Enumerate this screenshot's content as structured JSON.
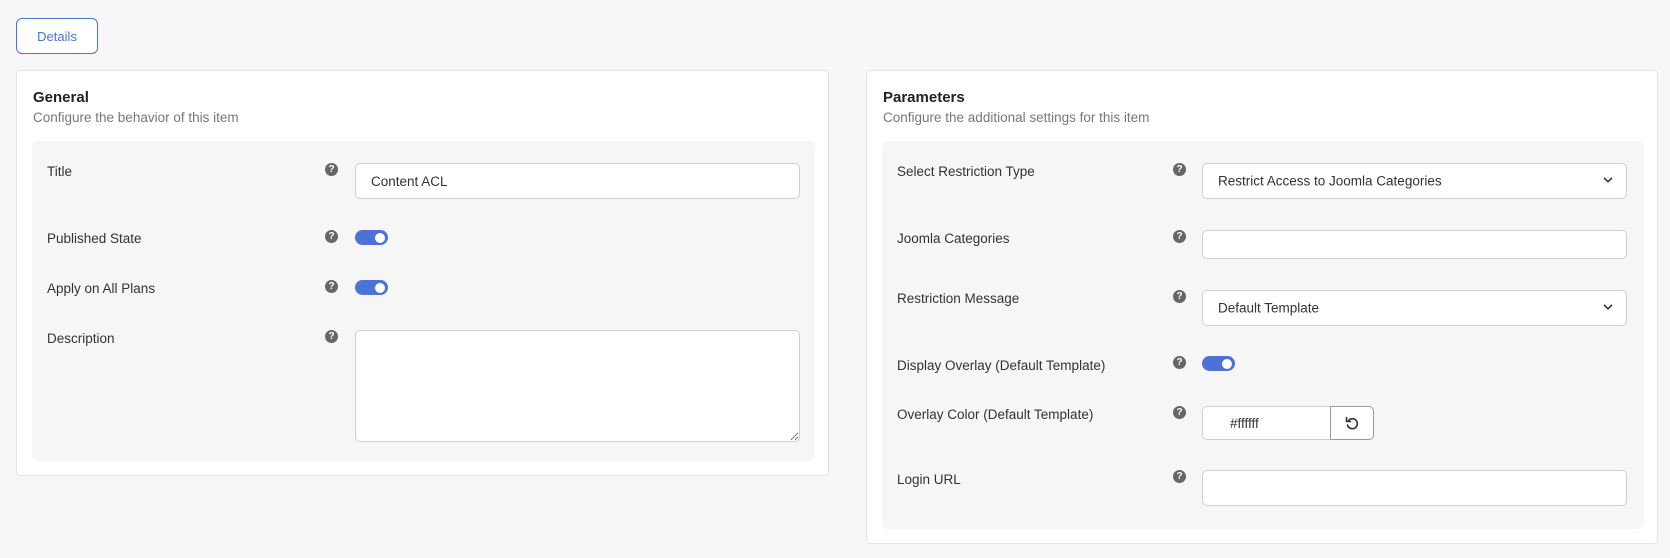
{
  "tabs": [
    {
      "label": "Details"
    }
  ],
  "general": {
    "title": "General",
    "subtitle": "Configure the behavior of this item",
    "fields": {
      "title": {
        "label": "Title",
        "value": "Content ACL"
      },
      "published": {
        "label": "Published State",
        "enabled": true
      },
      "apply_all": {
        "label": "Apply on All Plans",
        "enabled": true
      },
      "description": {
        "label": "Description",
        "value": ""
      }
    }
  },
  "parameters": {
    "title": "Parameters",
    "subtitle": "Configure the additional settings for this item",
    "fields": {
      "restriction_type": {
        "label": "Select Restriction Type",
        "value": "Restrict Access to Joomla Categories"
      },
      "categories": {
        "label": "Joomla Categories",
        "value": ""
      },
      "restriction_message": {
        "label": "Restriction Message",
        "value": "Default Template"
      },
      "display_overlay": {
        "label": "Display Overlay (Default Template)",
        "enabled": true
      },
      "overlay_color": {
        "label": "Overlay Color (Default Template)",
        "value": "#ffffff"
      },
      "login_url": {
        "label": "Login URL",
        "value": ""
      }
    }
  },
  "icons": {
    "help": "question-circle-icon",
    "select": "chevron-down-icon",
    "reset": "undo-icon"
  },
  "colors": {
    "accent": "#4b72d6",
    "help_icon": "#666666",
    "background": "#f7f7f7"
  }
}
